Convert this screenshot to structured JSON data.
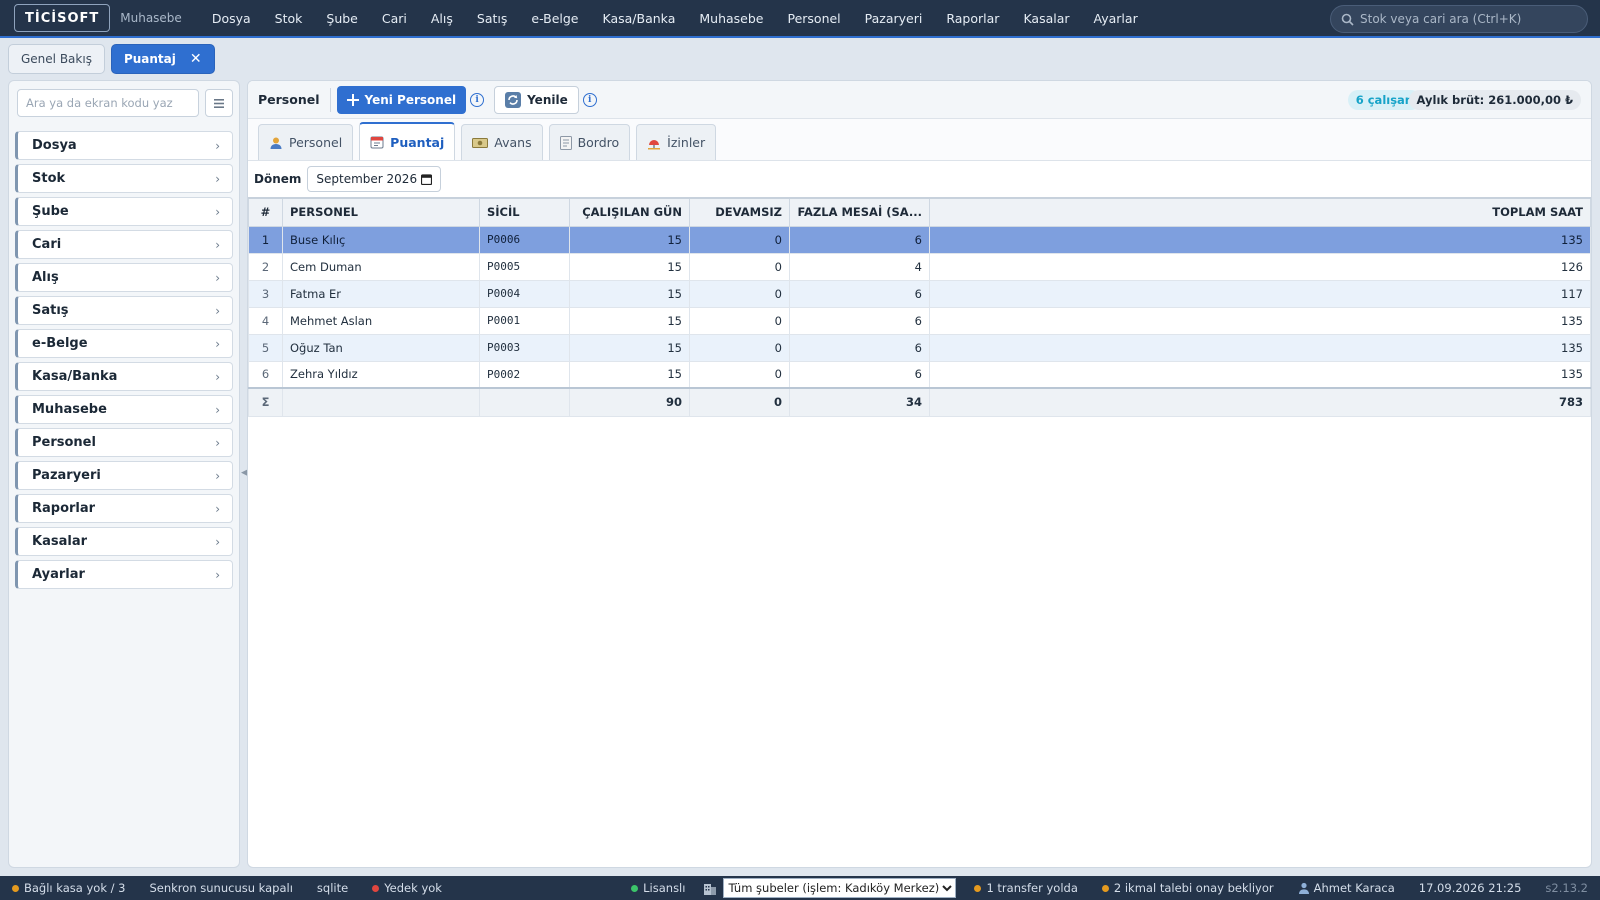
{
  "app": {
    "logo": "TİCİSOFT",
    "module": "Muhasebe"
  },
  "menu": [
    "Dosya",
    "Stok",
    "Şube",
    "Cari",
    "Alış",
    "Satış",
    "e-Belge",
    "Kasa/Banka",
    "Muhasebe",
    "Personel",
    "Pazaryeri",
    "Raporlar",
    "Kasalar",
    "Ayarlar"
  ],
  "search": {
    "placeholder": "Stok veya cari ara (Ctrl+K)",
    "icon": "search-icon"
  },
  "tabs": [
    {
      "label": "Genel Bakış",
      "active": false
    },
    {
      "label": "Puantaj",
      "active": true,
      "close": "✕"
    }
  ],
  "leftpanel": {
    "search_placeholder": "Ara ya da ekran kodu yaz",
    "items": [
      "Dosya",
      "Stok",
      "Şube",
      "Cari",
      "Alış",
      "Satış",
      "e-Belge",
      "Kasa/Banka",
      "Muhasebe",
      "Personel",
      "Pazaryeri",
      "Raporlar",
      "Kasalar",
      "Ayarlar"
    ]
  },
  "toolbar": {
    "title": "Personel",
    "new_button": "Yeni Personel",
    "refresh_button": "Yenile",
    "employee_count": "6 çalışan",
    "monthly_gross": "Aylık brüt: 261.000,00 ₺"
  },
  "subtabs": [
    {
      "label": "Personel",
      "icon": "person-icon",
      "active": false
    },
    {
      "label": "Puantaj",
      "icon": "calendar-icon",
      "active": true
    },
    {
      "label": "Avans",
      "icon": "cash-icon",
      "active": false
    },
    {
      "label": "Bordro",
      "icon": "document-icon",
      "active": false
    },
    {
      "label": "İzinler",
      "icon": "leave-icon",
      "active": false
    }
  ],
  "period": {
    "label": "Dönem",
    "value": "September  2026"
  },
  "table": {
    "headers": [
      "#",
      "PERSONEL",
      "SİCİL",
      "ÇALIŞILAN GÜN",
      "DEVAMSIZ",
      "FAZLA MESAİ (SA...",
      "TOPLAM SAAT"
    ],
    "rows": [
      {
        "no": "1",
        "name": "Buse Kılıç",
        "sicil": "P0006",
        "days": "15",
        "absent": "0",
        "overtime": "6",
        "total": "135"
      },
      {
        "no": "2",
        "name": "Cem Duman",
        "sicil": "P0005",
        "days": "15",
        "absent": "0",
        "overtime": "4",
        "total": "126"
      },
      {
        "no": "3",
        "name": "Fatma Er",
        "sicil": "P0004",
        "days": "15",
        "absent": "0",
        "overtime": "6",
        "total": "117"
      },
      {
        "no": "4",
        "name": "Mehmet Aslan",
        "sicil": "P0001",
        "days": "15",
        "absent": "0",
        "overtime": "6",
        "total": "135"
      },
      {
        "no": "5",
        "name": "Oğuz Tan",
        "sicil": "P0003",
        "days": "15",
        "absent": "0",
        "overtime": "6",
        "total": "135"
      },
      {
        "no": "6",
        "name": "Zehra Yıldız",
        "sicil": "P0002",
        "days": "15",
        "absent": "0",
        "overtime": "6",
        "total": "135"
      }
    ],
    "totals": {
      "symbol": "Σ",
      "days": "90",
      "absent": "0",
      "overtime": "34",
      "total": "783"
    }
  },
  "statusbar": {
    "kasa": "Bağlı kasa yok / 3",
    "sync": "Senkron sunucusu kapalı",
    "db": "sqlite",
    "backup": "Yedek yok",
    "license": "Lisanslı",
    "branch_select": "Tüm şubeler (işlem: Kadıköy Merkez)",
    "transfer": "1 transfer yolda",
    "approval": "2 ikmal talebi onay bekliyor",
    "user": "Ahmet Karaca",
    "datetime": "17.09.2026 21:25",
    "version": "s2.13.2"
  },
  "colors": {
    "accent": "#2f6fd0",
    "topbar": "#24344a",
    "selected_row": "#7e9fde",
    "warning_dot": "#e59a1f",
    "ok_dot": "#3cc46a",
    "error_dot": "#e0463f"
  }
}
